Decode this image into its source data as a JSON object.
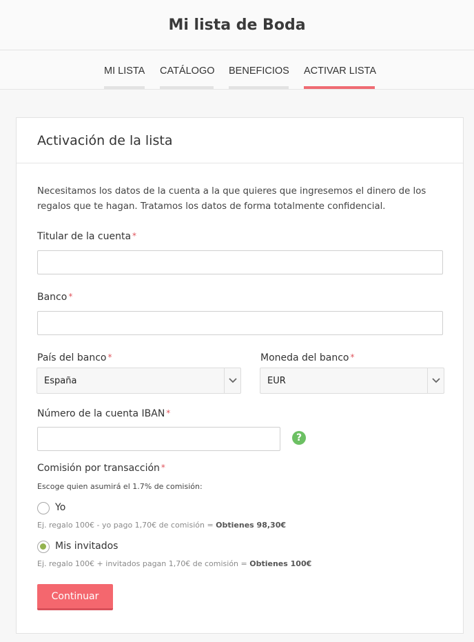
{
  "header": {
    "title": "Mi lista de Boda"
  },
  "nav": {
    "tabs": [
      {
        "label": "MI LISTA",
        "active": false
      },
      {
        "label": "CATÁLOGO",
        "active": false
      },
      {
        "label": "BENEFICIOS",
        "active": false
      },
      {
        "label": "ACTIVAR LISTA",
        "active": true
      }
    ]
  },
  "card": {
    "title": "Activación de la lista",
    "intro": "Necesitamos los datos de la cuenta a la que quieres que ingresemos el dinero de los regalos que te hagan. Tratamos los datos de forma totalmente confidencial.",
    "required_mark": "*"
  },
  "form": {
    "holder": {
      "label": "Titular de la cuenta",
      "value": ""
    },
    "bank": {
      "label": "Banco",
      "value": ""
    },
    "country": {
      "label": "País del banco",
      "value": "España"
    },
    "currency": {
      "label": "Moneda del banco",
      "value": "EUR"
    },
    "iban": {
      "label": "Número de la cuenta IBAN",
      "value": "",
      "help_icon": "question-icon"
    },
    "commission": {
      "label": "Comisión por transacción",
      "description": "Escoge quien asumirá el 1.7% de comisión:",
      "options": [
        {
          "label": "Yo",
          "note": "Ej. regalo 100€ - yo pago 1,70€ de comisión = ",
          "note_bold": "Obtienes 98,30€",
          "checked": false
        },
        {
          "label": "Mis invitados",
          "note": "Ej. regalo 100€ + invitados pagan 1,70€ de comisión = ",
          "note_bold": "Obtienes 100€",
          "checked": true
        }
      ]
    },
    "submit_label": "Continuar"
  },
  "colors": {
    "accent": "#f4676e",
    "radio_checked": "#93b34f",
    "help": "#6cc063"
  }
}
